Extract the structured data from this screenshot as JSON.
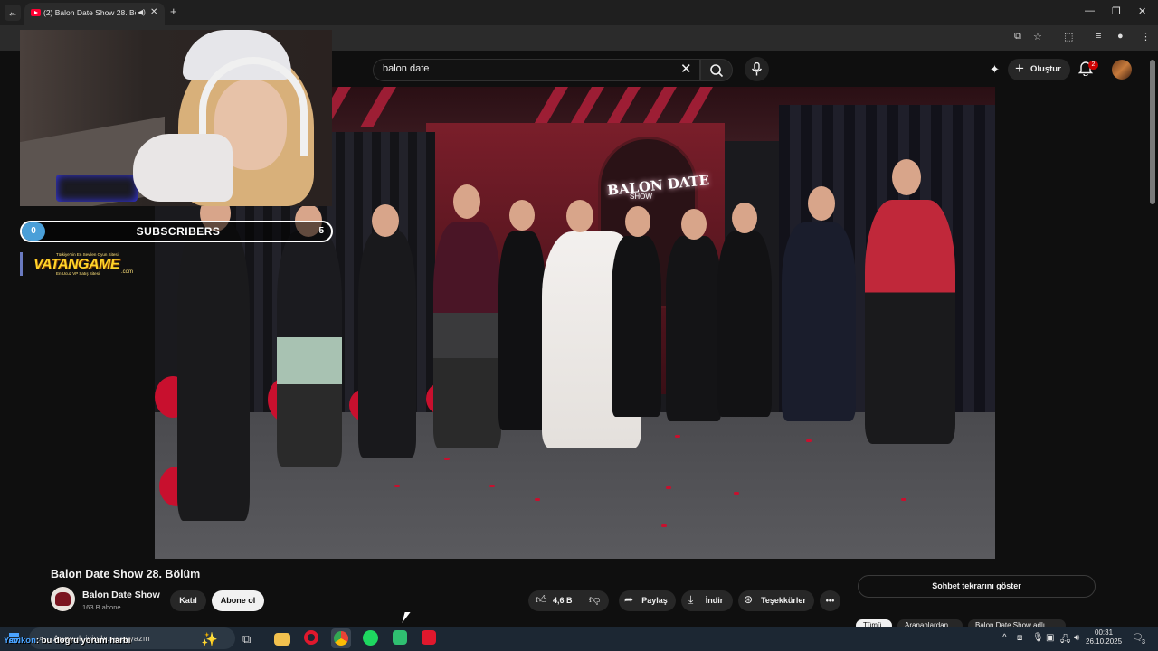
{
  "browser": {
    "tab_title": "(2) Balon Date Show 28. Bölüm",
    "new_tab": "+",
    "tab_close": "✕",
    "window": {
      "minimize": "—",
      "restore": "❐",
      "close": "✕"
    }
  },
  "youtube": {
    "search": {
      "value": "balon date",
      "clear": "✕"
    },
    "create_label": "Oluştur",
    "notification_count": "2"
  },
  "overlay": {
    "subscribers_left": "0",
    "subscribers_label": "SUBSCRIBERS",
    "subscribers_right": "5",
    "sponsor_tagline": "Türkiye'nin En Sevilen Oyun Sitesi",
    "sponsor_brand": "VATANGAME",
    "sponsor_sub": "En Ucuz VP Satış Sitesi",
    "sponsor_com": ".com"
  },
  "video": {
    "neon_sign": "BALON DATE",
    "neon_sub": "SHOW"
  },
  "info": {
    "title": "Balon Date Show 28. Bölüm",
    "channel_name": "Balon Date Show",
    "channel_subs": "163 B abone",
    "join_label": "Katıl",
    "subscribe_label": "Abone ol",
    "like_count": "4,6 B",
    "share_label": "Paylaş",
    "download_label": "İndir",
    "thanks_label": "Teşekkürler",
    "more": "•••",
    "chat_replay": "Sohbet tekrarını göster",
    "chips": [
      "Tümü",
      "Arananlardan",
      "Balon Date Show adlı..."
    ]
  },
  "taskbar": {
    "search_placeholder": "Aramak için buraya yazın",
    "overlay_user": "Yavikon",
    "overlay_text": ": bu doğru yorum harbi",
    "time": "00:31",
    "date": "26.10.2025",
    "notifications": "3"
  }
}
